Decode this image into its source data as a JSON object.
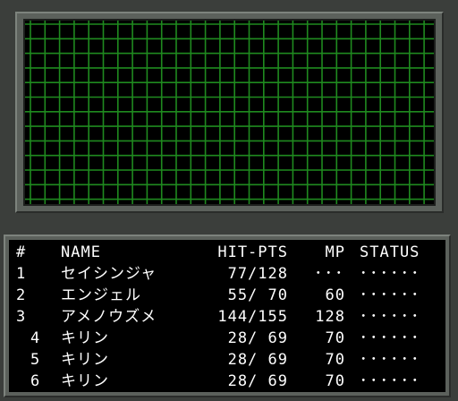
{
  "header": {
    "num": "#",
    "name": "NAME",
    "hp": "HIT-PTS",
    "mp": "MP",
    "status": "STATUS"
  },
  "party": [
    {
      "slot": "1",
      "name": "セイシンジャ",
      "hp": "77/128",
      "mp": "･･･",
      "status": "･･････"
    },
    {
      "slot": "2",
      "name": "エンジェル",
      "hp": "55/ 70",
      "mp": "60",
      "status": "･･････"
    },
    {
      "slot": "3",
      "name": "アメノウズメ",
      "hp": "144/155",
      "mp": "128",
      "status": "･･････"
    },
    {
      "slot": "4",
      "name": "キリン",
      "hp": "28/ 69",
      "mp": "70",
      "status": "･･････"
    },
    {
      "slot": "5",
      "name": "キリン",
      "hp": "28/ 69",
      "mp": "70",
      "status": "･･････"
    },
    {
      "slot": "6",
      "name": "キリン",
      "hp": "28/ 69",
      "mp": "70",
      "status": "･･････"
    }
  ],
  "colors": {
    "grid": "#1f8a1f",
    "background": "#000000",
    "frame": "#5c615c",
    "text": "#ffffff"
  }
}
